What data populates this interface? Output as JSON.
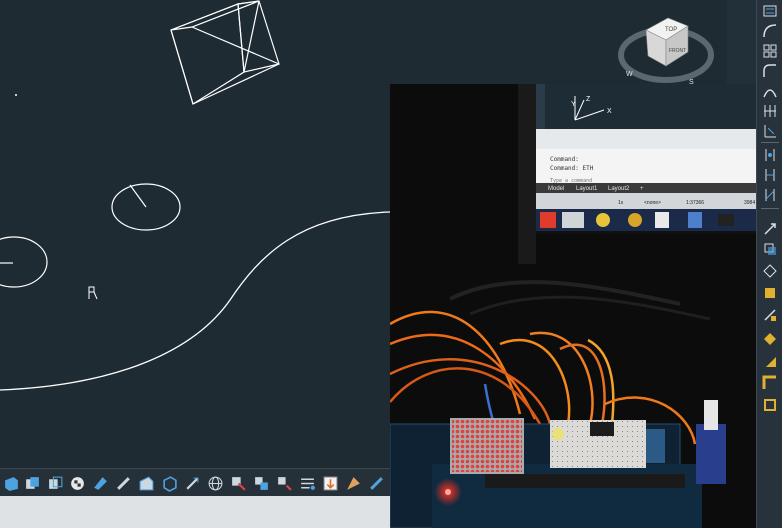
{
  "viewcube": {
    "top_label": "TOP",
    "front_label": "FRONT",
    "compass_w": "W",
    "compass_s": "S"
  },
  "photo": {
    "ucs_x": "X",
    "ucs_y": "Y",
    "ucs_z": "Z",
    "command_lines": [
      "Command:",
      "Command: ETH"
    ],
    "command_prompt": "Type a command",
    "tabs": [
      "Model",
      "Layout1",
      "Layout2",
      "+"
    ],
    "status": {
      "units": "1x",
      "layer": "<none>",
      "scale": "1:37366",
      "coord": "3984"
    }
  },
  "colors": {
    "background": "#1f2b33",
    "lines": "#ffffff",
    "toolbar": "#27323c",
    "accent": "#4da3e0"
  }
}
